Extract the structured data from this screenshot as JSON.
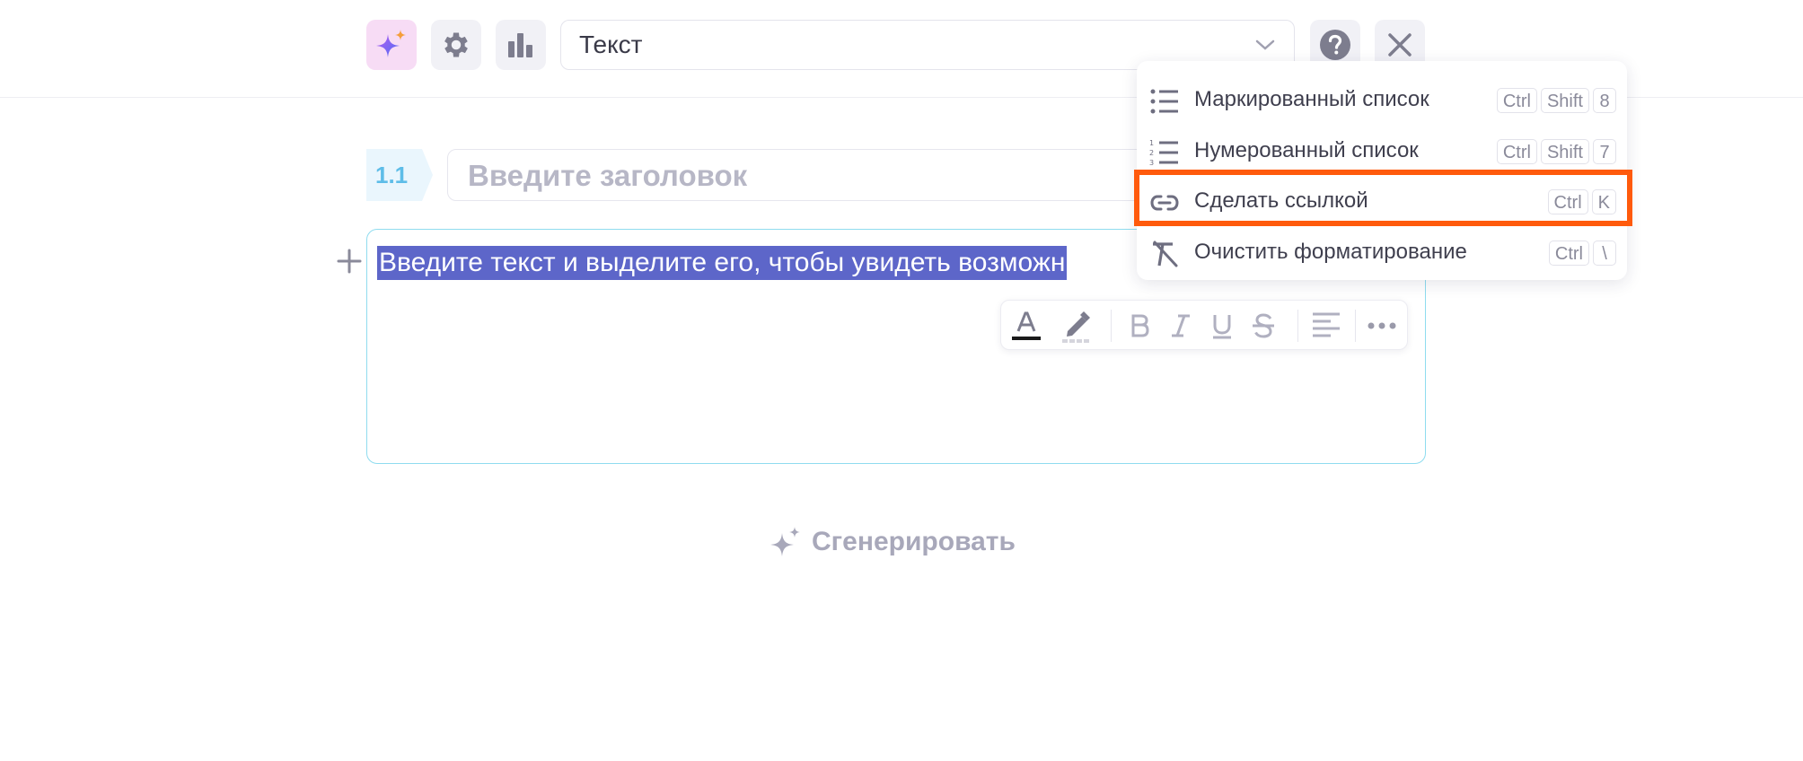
{
  "toolbar": {
    "block_type_value": "Текст"
  },
  "editor": {
    "section_number": "1.1",
    "heading_placeholder": "Введите заголовок",
    "selected_text": "Введите текст и выделите его, чтобы увидеть возможн"
  },
  "generate_label": "Сгенерировать",
  "menu": {
    "items": [
      {
        "label": "Маркированный список",
        "keys": [
          "Ctrl",
          "Shift",
          "8"
        ],
        "icon": "bulleted-list-icon"
      },
      {
        "label": "Нумерованный список",
        "keys": [
          "Ctrl",
          "Shift",
          "7"
        ],
        "icon": "numbered-list-icon"
      },
      {
        "label": "Сделать ссылкой",
        "keys": [
          "Ctrl",
          "K"
        ],
        "icon": "link-icon",
        "highlighted": true
      },
      {
        "label": "Очистить форматирование",
        "keys": [
          "Ctrl",
          "\\"
        ],
        "icon": "clear-format-icon"
      }
    ]
  },
  "colors": {
    "accent_highlight": "#ff5a0c",
    "selection": "#5d66c9",
    "section_number": "#5ebde8",
    "text_block_border": "#8fdcef"
  }
}
